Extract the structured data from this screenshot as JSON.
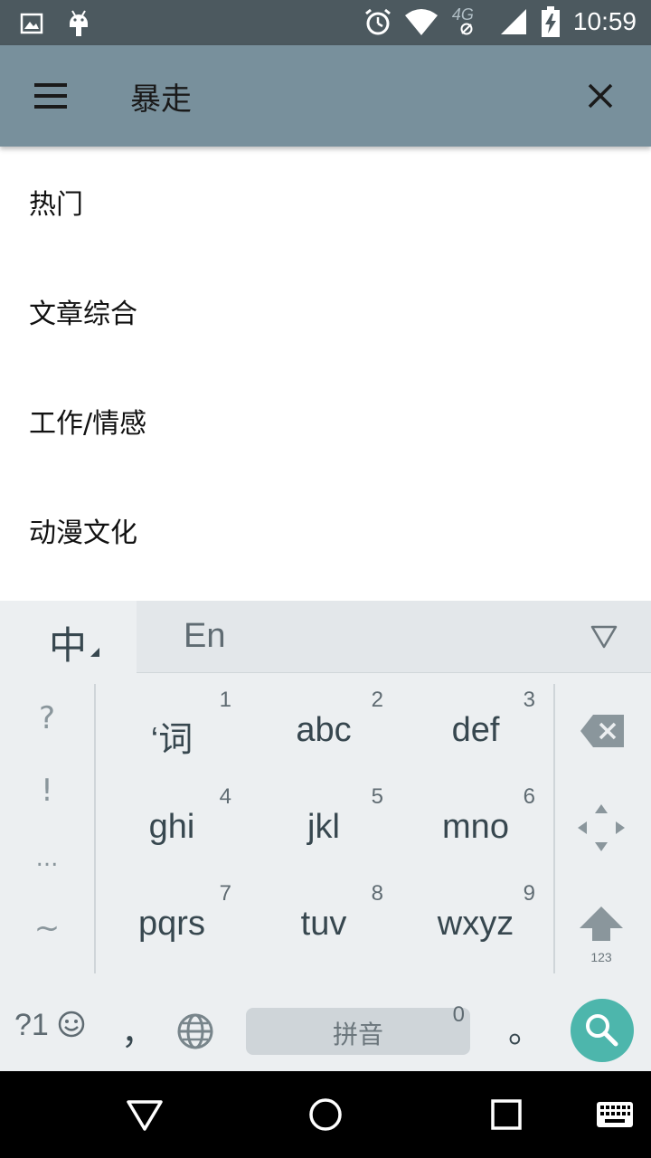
{
  "status_bar": {
    "time": "10:59",
    "network_label": "4G",
    "icons": [
      "image-icon",
      "android-icon",
      "alarm-icon",
      "wifi-icon",
      "cellular-signal-icon",
      "battery-charging-icon"
    ]
  },
  "toolbar": {
    "title": "暴走",
    "menu_icon": "hamburger-menu-icon",
    "close_icon": "close-icon",
    "background_color": "#78909c"
  },
  "list": {
    "items": [
      {
        "label": "热门"
      },
      {
        "label": "文章综合"
      },
      {
        "label": "工作/情感"
      },
      {
        "label": "动漫文化"
      }
    ]
  },
  "keyboard": {
    "lang_chinese": "中",
    "lang_english": "En",
    "punctuation": [
      "?",
      "!",
      "...",
      "~"
    ],
    "keys": [
      {
        "num": "1",
        "label": "‘词"
      },
      {
        "num": "2",
        "label": "abc"
      },
      {
        "num": "3",
        "label": "def"
      },
      {
        "num": "4",
        "label": "ghi"
      },
      {
        "num": "5",
        "label": "jkl"
      },
      {
        "num": "6",
        "label": "mno"
      },
      {
        "num": "7",
        "label": "pqrs"
      },
      {
        "num": "8",
        "label": "tuv"
      },
      {
        "num": "9",
        "label": "wxyz"
      }
    ],
    "shift_label": "123",
    "symbols_label": "?1",
    "comma": "，",
    "space_label": "拼音",
    "space_num": "0",
    "period": "。",
    "search_color": "#4db6ac"
  },
  "nav_bar": {
    "icons": [
      "back-icon",
      "home-icon",
      "recents-icon",
      "keyboard-icon"
    ]
  }
}
